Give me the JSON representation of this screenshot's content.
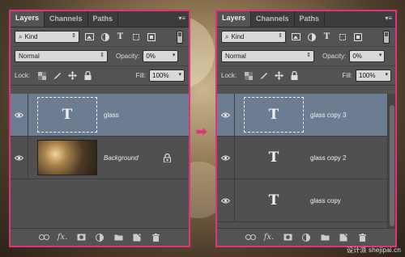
{
  "left_panel": {
    "tabs": [
      "Layers",
      "Channels",
      "Paths"
    ],
    "filter_label": "Kind",
    "blend_mode": "Normal",
    "opacity_label": "Opacity:",
    "opacity_value": "0%",
    "lock_label": "Lock:",
    "fill_label": "Fill:",
    "fill_value": "100%",
    "layers": [
      {
        "name": "glass",
        "type": "text",
        "thumb_glyph": "T",
        "selected": true
      },
      {
        "name": "Background",
        "type": "image",
        "locked": true,
        "selected": false
      }
    ]
  },
  "right_panel": {
    "tabs": [
      "Layers",
      "Channels",
      "Paths"
    ],
    "filter_label": "Kind",
    "blend_mode": "Normal",
    "opacity_label": "Opacity:",
    "opacity_value": "0%",
    "lock_label": "Lock:",
    "fill_label": "Fill:",
    "fill_value": "100%",
    "layers": [
      {
        "name": "glass copy 3",
        "type": "text",
        "thumb_glyph": "T",
        "selected": true
      },
      {
        "name": "glass copy 2",
        "type": "text",
        "thumb_glyph": "T",
        "selected": false
      },
      {
        "name": "glass copy",
        "type": "text",
        "thumb_glyph": "T",
        "selected": false
      }
    ]
  },
  "fx_label": "fx.",
  "arrow_glyph": "➡",
  "watermark": "设计派 shejipai.cn",
  "colors": {
    "highlight_border": "#e0337c",
    "selected_layer": "#6c7d92",
    "panel_bg": "#535353"
  }
}
